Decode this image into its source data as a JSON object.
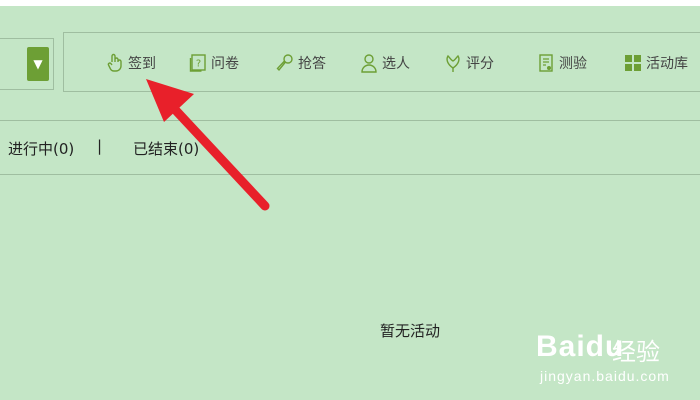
{
  "toolbar": {
    "items": [
      {
        "label": "签到",
        "icon": "hand-icon"
      },
      {
        "label": "问卷",
        "icon": "questionnaire-icon"
      },
      {
        "label": "抢答",
        "icon": "microphone-icon"
      },
      {
        "label": "选人",
        "icon": "person-icon"
      },
      {
        "label": "评分",
        "icon": "rating-icon"
      },
      {
        "label": "测验",
        "icon": "quiz-icon"
      },
      {
        "label": "活动库",
        "icon": "grid-icon"
      }
    ],
    "dropdown_arrow": "▼"
  },
  "tabs": {
    "in_progress": "进行中(0)",
    "separator": "|",
    "ended": "已结束(0)"
  },
  "empty_message": "暂无活动",
  "watermark": {
    "logo": "Baidu",
    "jingyan": "经验",
    "url": "jingyan.baidu.com"
  },
  "colors": {
    "background": "#c4e6c6",
    "accent": "#6d9f35",
    "icon": "#6d9f35",
    "arrow": "#e8202a"
  }
}
